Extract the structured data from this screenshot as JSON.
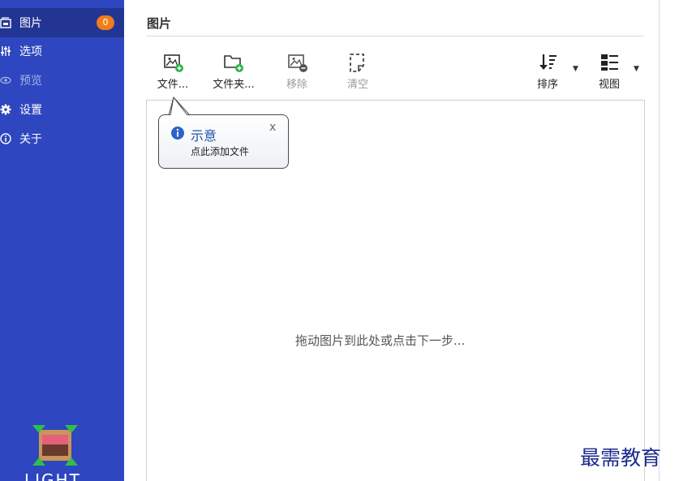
{
  "sidebar": {
    "items": [
      {
        "label": "图片",
        "icon": "images-icon",
        "badge": "0",
        "active": true
      },
      {
        "label": "选项",
        "icon": "sliders-icon"
      },
      {
        "label": "预览",
        "icon": "eye-icon",
        "disabled": true
      },
      {
        "label": "设置",
        "icon": "gear-icon"
      },
      {
        "label": "关于",
        "icon": "info-icon"
      }
    ],
    "logo_text": "LIGHT",
    "bg_color": "#2e46bf",
    "active_color": "#233593",
    "badge_color": "#f07c1b"
  },
  "main": {
    "title": "图片",
    "toolbar": {
      "add_file": "文件...",
      "add_folder": "文件夹...",
      "remove": "移除",
      "clear": "清空",
      "sort": "排序",
      "view": "视图"
    },
    "drop_hint": "拖动图片到此处或点击下一步...",
    "tooltip": {
      "title": "示意",
      "body": "点此添加文件",
      "close": "x"
    }
  },
  "watermark": "最需教育"
}
